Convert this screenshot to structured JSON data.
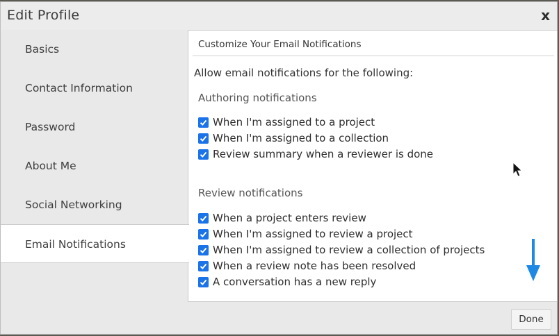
{
  "dialog": {
    "title": "Edit Profile",
    "close_label": "x"
  },
  "sidebar": {
    "items": [
      {
        "label": "Basics",
        "active": false
      },
      {
        "label": "Contact Information",
        "active": false
      },
      {
        "label": "Password",
        "active": false
      },
      {
        "label": "About Me",
        "active": false
      },
      {
        "label": "Social Networking",
        "active": false
      },
      {
        "label": "Email Notifications",
        "active": true
      }
    ]
  },
  "content": {
    "header": "Customize Your Email Notifications",
    "intro": "Allow email notifications for the following:",
    "groups": [
      {
        "title": "Authoring notifications",
        "options": [
          {
            "label": "When I'm assigned to a project",
            "checked": true
          },
          {
            "label": "When I'm assigned to a collection",
            "checked": true
          },
          {
            "label": "Review summary when a reviewer is done",
            "checked": true
          }
        ]
      },
      {
        "title": "Review notifications",
        "options": [
          {
            "label": "When a project enters review",
            "checked": true
          },
          {
            "label": "When I'm assigned to review a project",
            "checked": true
          },
          {
            "label": "When I'm assigned to review a collection of projects",
            "checked": true
          },
          {
            "label": "When a review note has been resolved",
            "checked": true
          },
          {
            "label": "A conversation has a new reply",
            "checked": true
          }
        ]
      }
    ]
  },
  "footer": {
    "done_label": "Done"
  },
  "colors": {
    "checkbox": "#1a73e8",
    "scroll_arrow": "#1e88e5"
  },
  "icons": {
    "close": "close-icon",
    "check": "checkmark-icon",
    "cursor": "mouse-pointer-icon",
    "arrow": "arrow-down-icon"
  }
}
